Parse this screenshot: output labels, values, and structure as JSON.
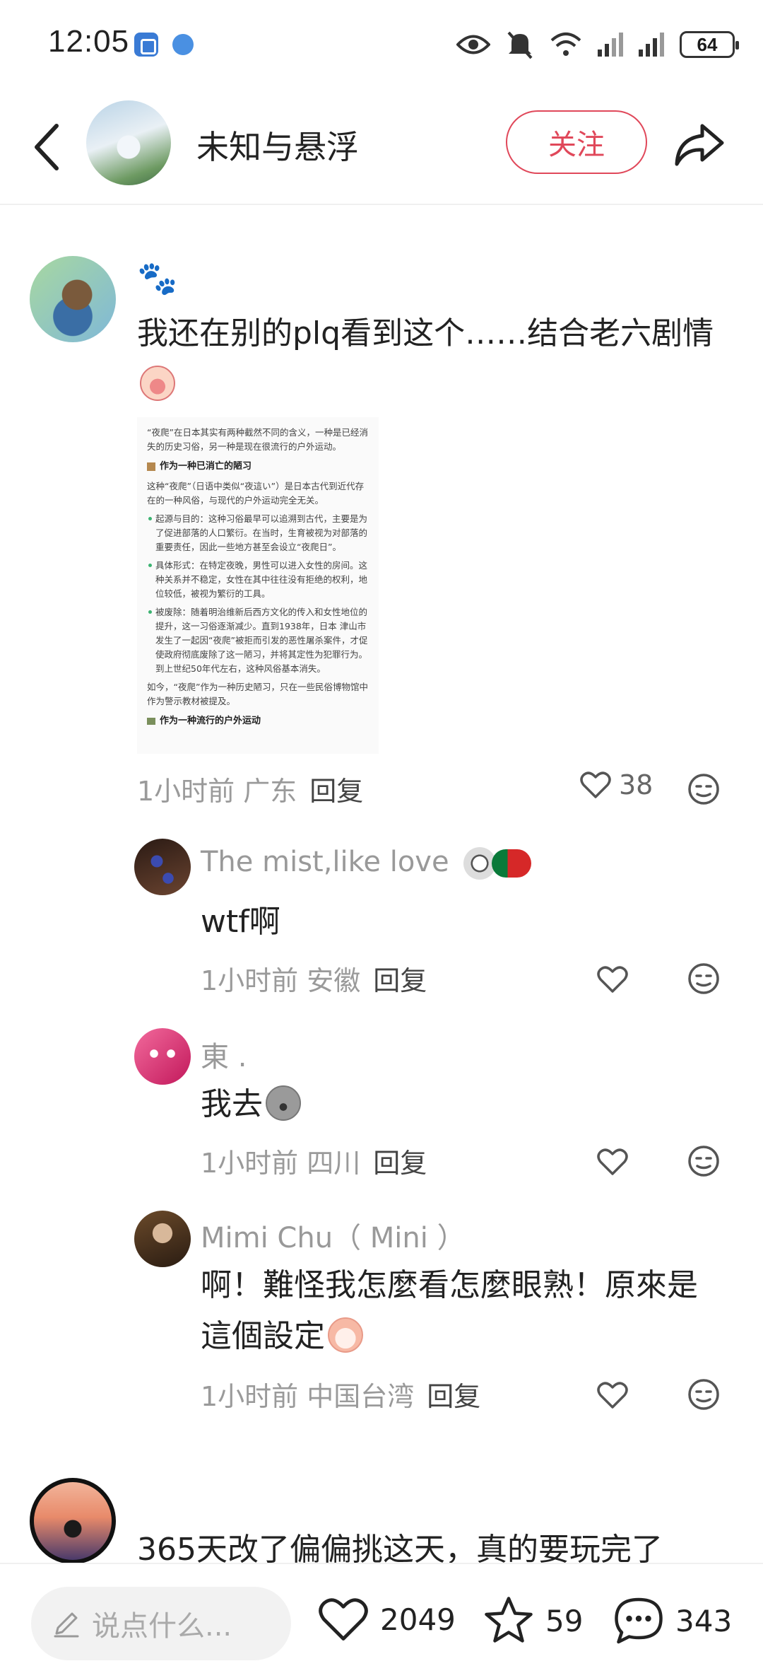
{
  "status_bar": {
    "time": "12:05",
    "battery": "64"
  },
  "header": {
    "author_name": "未知与悬浮",
    "follow_label": "关注"
  },
  "comments": [
    {
      "name": "🐾",
      "text": "我还在别的plq看到这个……结合老六剧情",
      "time": "1小时前",
      "location": "广东",
      "reply_label": "回复",
      "likes": "38",
      "embed": {
        "intro": "“夜爬”在日本其实有两种截然不同的含义，一种是已经消失的历史习俗，另一种是现在很流行的户外运动。",
        "heading1": "作为一种已消亡的陋习",
        "para1": "这种“夜爬”（日语中类似“夜這い”）是日本古代到近代存在的一种风俗，与现代的户外运动完全无关。",
        "bullet1": "起源与目的：这种习俗最早可以追溯到古代，主要是为了促进部落的人口繁衍。在当时，生育被视为对部落的重要责任，因此一些地方甚至会设立“夜爬日”。",
        "bullet2": "具体形式：在特定夜晚，男性可以进入女性的房间。这种关系并不稳定，女性在其中往往没有拒绝的权利，地位较低，被视为繁衍的工具。",
        "bullet3": "被废除：随着明治维新后西方文化的传入和女性地位的提升，这一习俗逐渐减少。直到1938年，日本 津山市 发生了一起因“夜爬”被拒而引发的恶性屠杀案件，才促使政府彻底废除了这一陋习，并将其定性为犯罪行为。到上世纪50年代左右，这种风俗基本消失。",
        "para2": "如今，“夜爬”作为一种历史陋习，只在一些民俗博物馆中作为警示教材被提及。",
        "heading2": "作为一种流行的户外运动"
      }
    },
    {
      "name": "The mist,like love",
      "text": "wtf啊",
      "time": "1小时前",
      "location": "安徽",
      "reply_label": "回复"
    },
    {
      "name": "東 .",
      "text": "我去",
      "time": "1小时前",
      "location": "四川",
      "reply_label": "回复"
    },
    {
      "name": "Mimi Chu（ Mini ）",
      "text_line1": "啊！難怪我怎麼看怎麼眼熟！原來是",
      "text_line2": "這個設定",
      "time": "1小时前",
      "location": "中国台湾",
      "reply_label": "回复"
    },
    {
      "text": "365天改了偏偏挑这天，真的要玩完了"
    }
  ],
  "bottom_bar": {
    "input_placeholder": "说点什么...",
    "likes": "2049",
    "stars": "59",
    "comments": "343"
  },
  "colors": {
    "accent": "#e0485a",
    "muted_text": "#9a9a9a"
  }
}
